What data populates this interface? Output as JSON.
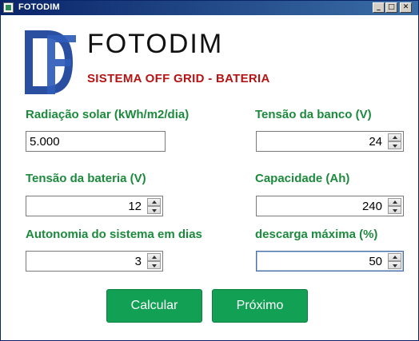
{
  "window": {
    "title": "FOTODIM",
    "minimize": "_",
    "maximize": "□",
    "close": "✕"
  },
  "header": {
    "logo": "DF",
    "brand": "FOTODIM",
    "subtitle": "SISTEMA OFF GRID - BATERIA"
  },
  "form": {
    "radiacao": {
      "label": "Radiação solar (kWh/m2/dia)",
      "value": "5.000"
    },
    "tensao_banco": {
      "label": "Tensão da banco (V)",
      "value": "24"
    },
    "tensao_bateria": {
      "label": "Tensão da bateria (V)",
      "value": "12"
    },
    "capacidade": {
      "label": "Capacidade (Ah)",
      "value": "240"
    },
    "autonomia": {
      "label": "Autonomia do sistema em dias",
      "value": "3"
    },
    "descarga": {
      "label": "descarga máxima (%)",
      "value": "50"
    }
  },
  "buttons": {
    "calcular": "Calcular",
    "proximo": "Próximo"
  },
  "colors": {
    "label_green": "#1c8a3c",
    "subtitle_red": "#b41414",
    "button_green": "#12a055",
    "logo_blue": "#2a4fa0"
  }
}
